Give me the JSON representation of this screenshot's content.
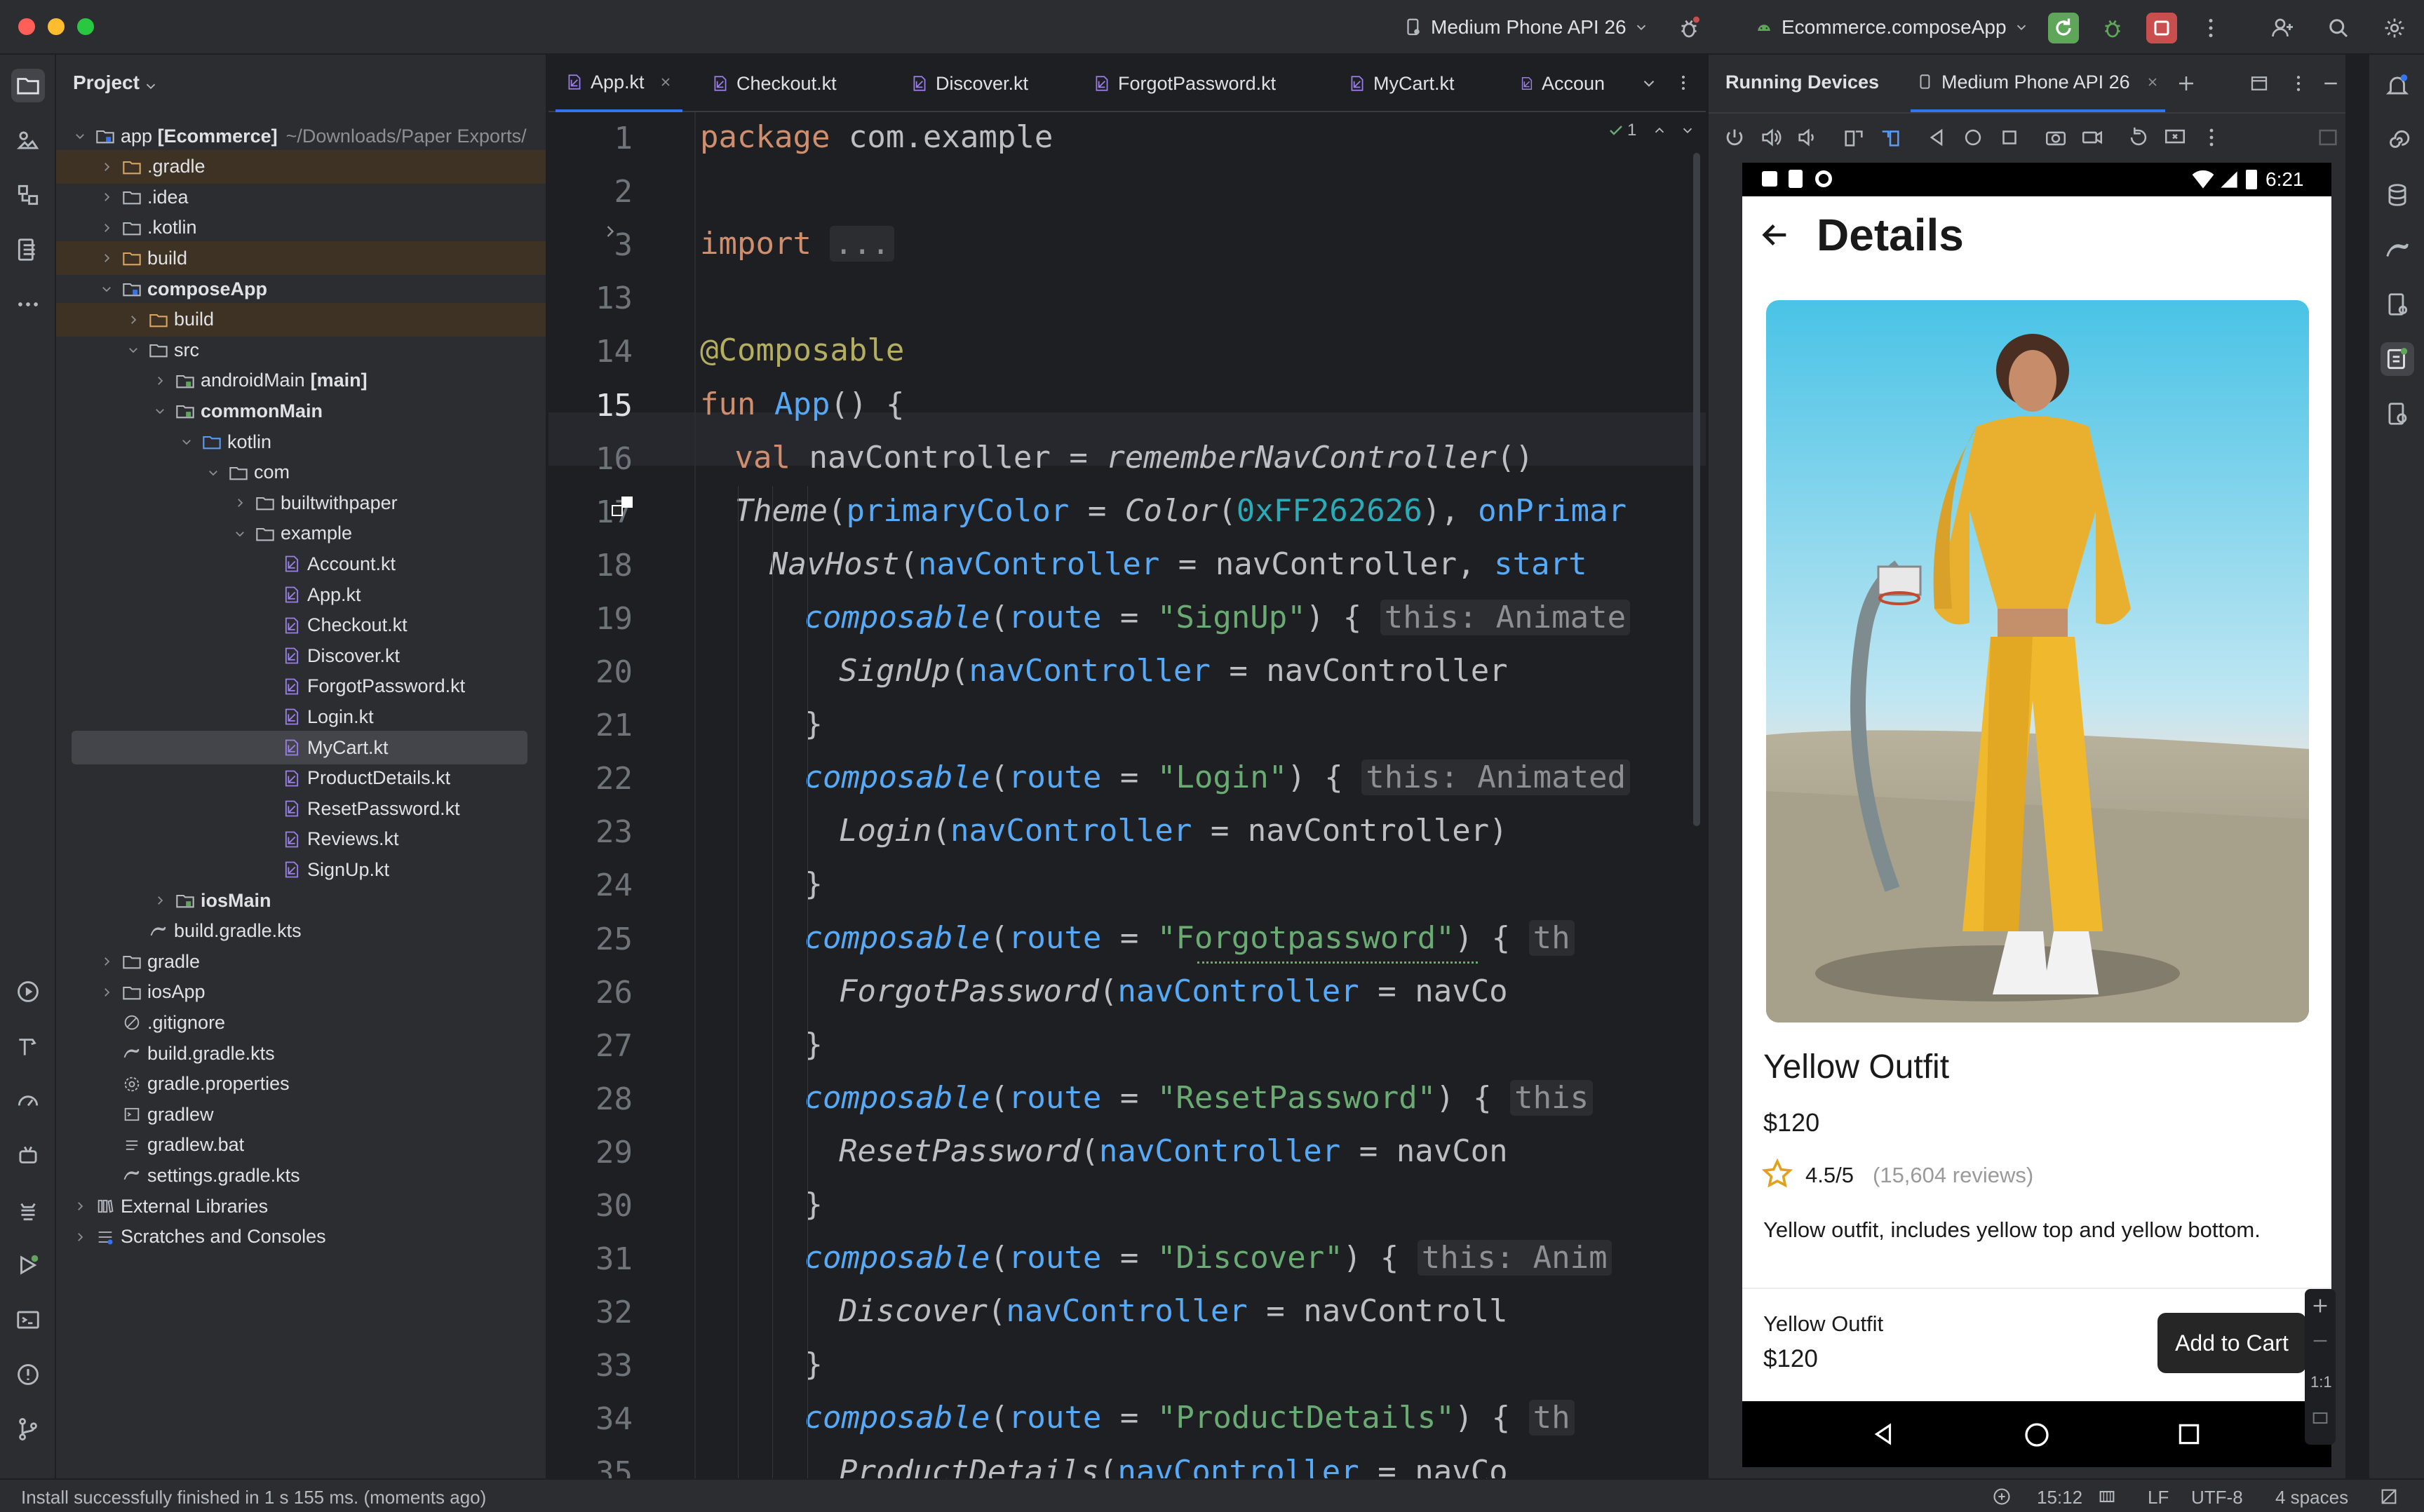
{
  "titlebar": {
    "device_selector": "Medium Phone API 26",
    "run_config": "Ecommerce.composeApp",
    "colors": {
      "run": "#5fa55a",
      "stop": "#c94f4f",
      "accent": "#3574f0"
    }
  },
  "project": {
    "title": "Project",
    "tree": [
      {
        "label": "app [Ecommerce]",
        "extra": "~/Downloads/Paper Exports/",
        "depth": 0,
        "expanded": true,
        "icon": "module-icon",
        "bold_part": "[Ecommerce]"
      },
      {
        "label": ".gradle",
        "depth": 1,
        "expanded": false,
        "icon": "folder-orange-icon",
        "highlight": "excluded"
      },
      {
        "label": ".idea",
        "depth": 1,
        "expanded": false,
        "icon": "folder-icon"
      },
      {
        "label": ".kotlin",
        "depth": 1,
        "expanded": false,
        "icon": "folder-icon"
      },
      {
        "label": "build",
        "depth": 1,
        "expanded": false,
        "icon": "folder-orange-icon",
        "highlight": "excluded"
      },
      {
        "label": "composeApp",
        "depth": 1,
        "expanded": true,
        "icon": "module-icon",
        "bold": true
      },
      {
        "label": "build",
        "depth": 2,
        "expanded": false,
        "icon": "folder-orange-icon",
        "highlight": "excluded"
      },
      {
        "label": "src",
        "depth": 2,
        "expanded": true,
        "icon": "folder-icon"
      },
      {
        "label": "androidMain",
        "suffix": "[main]",
        "depth": 3,
        "expanded": false,
        "icon": "source-folder-icon"
      },
      {
        "label": "commonMain",
        "depth": 3,
        "expanded": true,
        "icon": "source-folder-icon",
        "bold": true
      },
      {
        "label": "kotlin",
        "depth": 4,
        "expanded": true,
        "icon": "folder-blue-icon"
      },
      {
        "label": "com",
        "depth": 5,
        "expanded": true,
        "icon": "folder-icon"
      },
      {
        "label": "builtwithpaper",
        "depth": 6,
        "expanded": false,
        "icon": "folder-icon"
      },
      {
        "label": "example",
        "depth": 6,
        "expanded": true,
        "icon": "folder-icon"
      },
      {
        "label": "Account.kt",
        "depth": 7,
        "icon": "kotlin-file-icon"
      },
      {
        "label": "App.kt",
        "depth": 7,
        "icon": "kotlin-file-icon"
      },
      {
        "label": "Checkout.kt",
        "depth": 7,
        "icon": "kotlin-file-icon"
      },
      {
        "label": "Discover.kt",
        "depth": 7,
        "icon": "kotlin-file-icon"
      },
      {
        "label": "ForgotPassword.kt",
        "depth": 7,
        "icon": "kotlin-file-icon"
      },
      {
        "label": "Login.kt",
        "depth": 7,
        "icon": "kotlin-file-icon"
      },
      {
        "label": "MyCart.kt",
        "depth": 7,
        "icon": "kotlin-file-icon",
        "highlight": "selected"
      },
      {
        "label": "ProductDetails.kt",
        "depth": 7,
        "icon": "kotlin-file-icon"
      },
      {
        "label": "ResetPassword.kt",
        "depth": 7,
        "icon": "kotlin-file-icon"
      },
      {
        "label": "Reviews.kt",
        "depth": 7,
        "icon": "kotlin-file-icon"
      },
      {
        "label": "SignUp.kt",
        "depth": 7,
        "icon": "kotlin-file-icon"
      },
      {
        "label": "iosMain",
        "depth": 3,
        "expanded": false,
        "icon": "source-folder-icon",
        "bold": true
      },
      {
        "label": "build.gradle.kts",
        "depth": 2,
        "icon": "gradle-file-icon"
      },
      {
        "label": "gradle",
        "depth": 1,
        "expanded": false,
        "icon": "folder-icon"
      },
      {
        "label": "iosApp",
        "depth": 1,
        "expanded": false,
        "icon": "folder-icon"
      },
      {
        "label": ".gitignore",
        "depth": 1,
        "icon": "ignore-file-icon"
      },
      {
        "label": "build.gradle.kts",
        "depth": 1,
        "icon": "gradle-file-icon"
      },
      {
        "label": "gradle.properties",
        "depth": 1,
        "icon": "settings-file-icon"
      },
      {
        "label": "gradlew",
        "depth": 1,
        "icon": "script-file-icon"
      },
      {
        "label": "gradlew.bat",
        "depth": 1,
        "icon": "text-file-icon"
      },
      {
        "label": "settings.gradle.kts",
        "depth": 1,
        "icon": "gradle-file-icon"
      },
      {
        "label": "External Libraries",
        "depth": 0,
        "expanded": false,
        "icon": "library-icon"
      },
      {
        "label": "Scratches and Consoles",
        "depth": 0,
        "expanded": false,
        "icon": "scratches-icon"
      }
    ]
  },
  "editor": {
    "tabs": [
      {
        "label": "App.kt",
        "active": true
      },
      {
        "label": "Checkout.kt"
      },
      {
        "label": "Discover.kt"
      },
      {
        "label": "ForgotPassword.kt"
      },
      {
        "label": "MyCart.kt"
      },
      {
        "label": "Accoun"
      }
    ],
    "inspection_count": "1",
    "line_numbers": [
      "1",
      "2",
      "3",
      "13",
      "14",
      "15",
      "16",
      "17",
      "18",
      "19",
      "20",
      "21",
      "22",
      "23",
      "24",
      "25",
      "26",
      "27",
      "28",
      "29",
      "30",
      "31",
      "32",
      "33",
      "34",
      "35"
    ],
    "lines": {
      "l1": "package com.example",
      "l3_kw": "import",
      "l3_fold": "...",
      "l14": "@Composable",
      "l15_kw": "fun",
      "l15_fn": "App",
      "l15_rest": "() {",
      "l16_kw": "val",
      "l16_rest": " navController = ",
      "l16_call": "rememberNavController",
      "l16_end": "()",
      "l17_call": "Theme",
      "l17_a": "(",
      "l17_named": "primaryColor",
      "l17_b": " = ",
      "l17_color": "Color",
      "l17_c": "(",
      "l17_num": "0xFF262626",
      "l17_d": "), ",
      "l17_named2": "onPrimar",
      "l18_call": "NavHost",
      "l18_a": "(",
      "l18_named": "navController",
      "l18_b": " = navController, ",
      "l18_named2": "start",
      "routes": [
        {
          "route": "\"SignUp\"",
          "hint": "this: Animate",
          "target": "SignUp",
          "rest": " = navController"
        },
        {
          "route": "\"Login\"",
          "hint": "this: Animated",
          "target": "Login",
          "rest": " = navController)"
        },
        {
          "route": "\"Forgotpassword\"",
          "hint": "th",
          "target": "ForgotPassword",
          "rest": " = navCo"
        },
        {
          "route": "\"ResetPassword\"",
          "hint": "this",
          "target": "ResetPassword",
          "rest": " = navCon"
        },
        {
          "route": "\"Discover\"",
          "hint": "this: Anim",
          "target": "Discover",
          "rest": " = navControll"
        },
        {
          "route": "\"ProductDetails\"",
          "hint": "th",
          "target": "ProductDetails",
          "rest": " = navCo"
        }
      ],
      "composable": "composable",
      "route_kw": "route",
      "nav_named": "navController",
      "close_brace": "}"
    }
  },
  "devices": {
    "panel_title": "Running Devices",
    "device_tab": "Medium Phone API 26"
  },
  "phone": {
    "time": "6:21",
    "screen_title": "Details",
    "product_name": "Yellow Outfit",
    "price": "$120",
    "rating": "4.5/5",
    "reviews": "(15,604 reviews)",
    "description": "Yellow outfit, includes yellow top and yellow bottom.",
    "bottom_name": "Yellow Outfit",
    "bottom_price": "$120",
    "add_to_cart": "Add to Cart",
    "zoom_label": "1:1"
  },
  "statusbar": {
    "message": "Install successfully finished in 1 s 155 ms. (moments ago)",
    "position": "15:12",
    "line_sep": "LF",
    "encoding": "UTF-8",
    "indent": "4 spaces"
  }
}
